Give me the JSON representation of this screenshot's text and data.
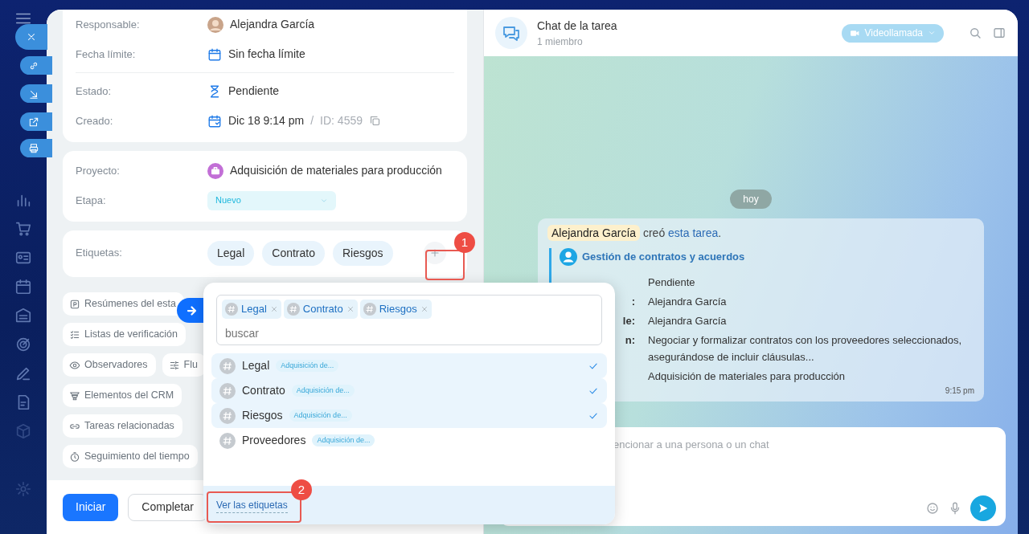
{
  "task": {
    "fields": [
      {
        "kind": "person",
        "label": "Responsable:",
        "value": "Alejandra García"
      },
      {
        "kind": "deadline",
        "label": "Fecha límite:",
        "value": "Sin fecha límite"
      },
      {
        "kind": "status",
        "label": "Estado:",
        "value": "Pendiente"
      },
      {
        "kind": "created",
        "label": "Creado:",
        "value": "Dic 18 9:14 pm",
        "separator": "/",
        "id": "ID: 4559"
      }
    ],
    "project": {
      "label": "Proyecto:",
      "value": "Adquisición de materiales para producción"
    },
    "stage": {
      "label": "Etapa:",
      "value": "Nuevo"
    },
    "tags": {
      "label": "Etiquetas:",
      "items": [
        "Legal",
        "Contrato",
        "Riesgos"
      ]
    },
    "sections": [
      [
        {
          "kind": "summary",
          "label": "Resúmenes del esta"
        }
      ],
      [
        {
          "kind": "checklist",
          "label": "Listas de verificación"
        }
      ],
      [
        {
          "kind": "observers",
          "label": "Observadores"
        },
        {
          "kind": "flow",
          "label": "Flu"
        }
      ],
      [
        {
          "kind": "crm",
          "label": "Elementos del CRM"
        }
      ],
      [
        {
          "kind": "related",
          "label": "Tareas relacionadas"
        }
      ],
      [
        {
          "kind": "time",
          "label": "Seguimiento del tiempo"
        }
      ]
    ],
    "actions": [
      {
        "label": "Iniciar",
        "primary": true
      },
      {
        "label": "Completar",
        "primary": false
      }
    ]
  },
  "chat": {
    "title": "Chat de la tarea",
    "subtitle": "1 miembro",
    "video_button": "Videollamada",
    "date_pill": "hoy",
    "message": {
      "author": "Alejandra García",
      "text_before": "creó ",
      "link": "esta tarea",
      "text_after": ".",
      "card_title": "Gestión de contratos y acuerdos",
      "rows": [
        {
          "value": "Pendiente"
        },
        {
          "label": ":",
          "value": "Alejandra García"
        },
        {
          "label": "le:",
          "value": "Alejandra García"
        },
        {
          "label": "n:",
          "value": "Negociar y formalizar contratos con los proveedores seleccionados, asegurándose de incluir cláusulas..."
        },
        {
          "value": "Adquisición de materiales para producción"
        }
      ],
      "time": "9:15 pm"
    },
    "composer": {
      "placeholder": "encionar a una persona o un chat"
    }
  },
  "tag_popup": {
    "chips": [
      "Legal",
      "Contrato",
      "Riesgos"
    ],
    "placeholder": "buscar",
    "options": [
      {
        "name": "Legal",
        "project": "Adquisición de...",
        "selected": true
      },
      {
        "name": "Contrato",
        "project": "Adquisición de...",
        "selected": true
      },
      {
        "name": "Riesgos",
        "project": "Adquisición de...",
        "selected": true
      },
      {
        "name": "Proveedores",
        "project": "Adquisición de...",
        "selected": false
      }
    ],
    "footer_link": "Ver las etiquetas"
  },
  "callouts": [
    "1",
    "2"
  ]
}
